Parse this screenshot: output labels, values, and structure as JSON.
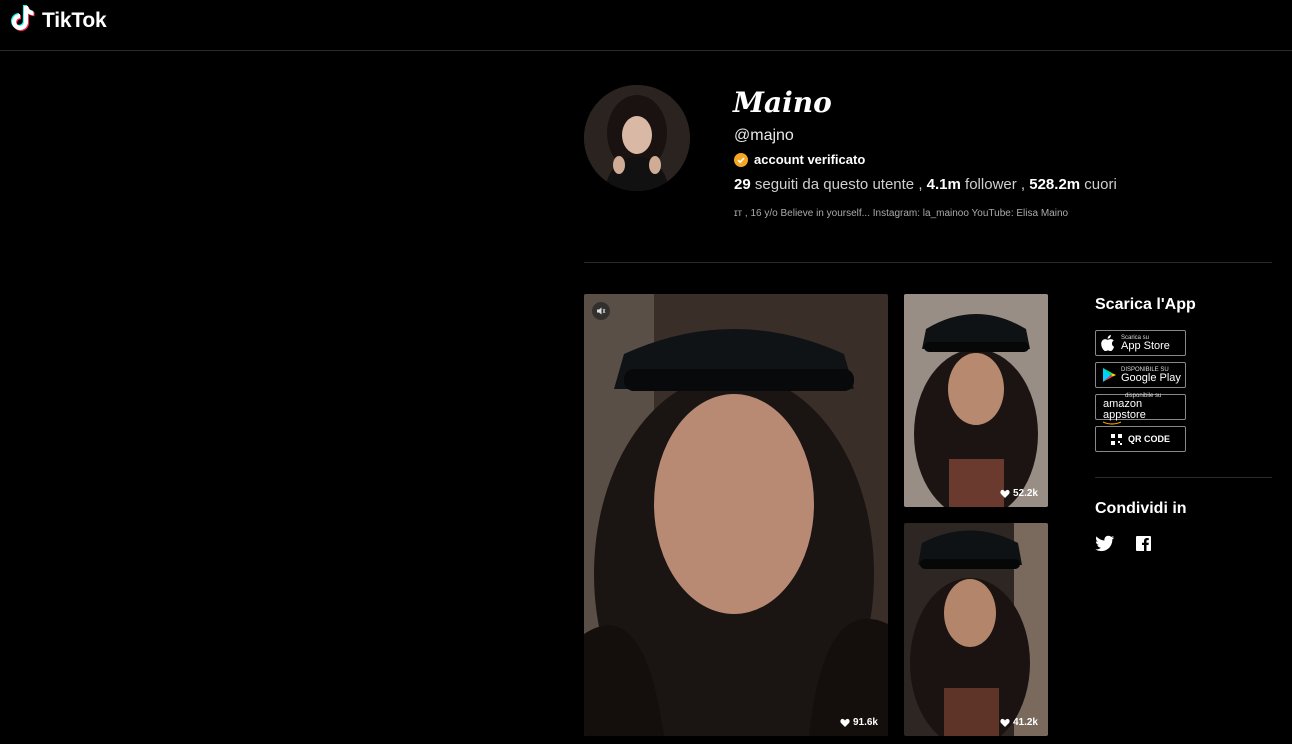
{
  "header": {
    "logo_text": "TikTok"
  },
  "profile": {
    "display_name": "Maino",
    "handle": "@majno",
    "verified_label": "account verificato",
    "following_count": "29",
    "following_label": "seguiti da questo utente",
    "followers_count": "4.1m",
    "followers_label": "follower",
    "likes_count": "528.2m",
    "likes_label": "cuori",
    "bio": "ɪᴛ , 16 y/o Believe in yourself... Instagram: la_mainoo YouTube: Elisa Maino"
  },
  "videos": [
    {
      "likes": "91.6k"
    },
    {
      "likes": "52.2k"
    },
    {
      "likes": "41.2k"
    }
  ],
  "sidebar": {
    "download_title": "Scarica l'App",
    "app_store": {
      "small": "Scarica su",
      "big": "App Store"
    },
    "google_play": {
      "small": "DISPONIBILE SU",
      "big": "Google Play"
    },
    "amazon": {
      "small": "disponibile su",
      "big": "amazon appstore"
    },
    "qr_label": "QR CODE",
    "share_title": "Condividi in"
  },
  "colors": {
    "background": "#000000",
    "verified_badge": "#f5a623",
    "divider": "#2a2a2a"
  },
  "icons": [
    "tiktok-logo-icon",
    "verified-check-icon",
    "mute-icon",
    "heart-icon",
    "apple-icon",
    "google-play-icon",
    "amazon-icon",
    "qr-code-icon",
    "twitter-icon",
    "facebook-icon"
  ]
}
